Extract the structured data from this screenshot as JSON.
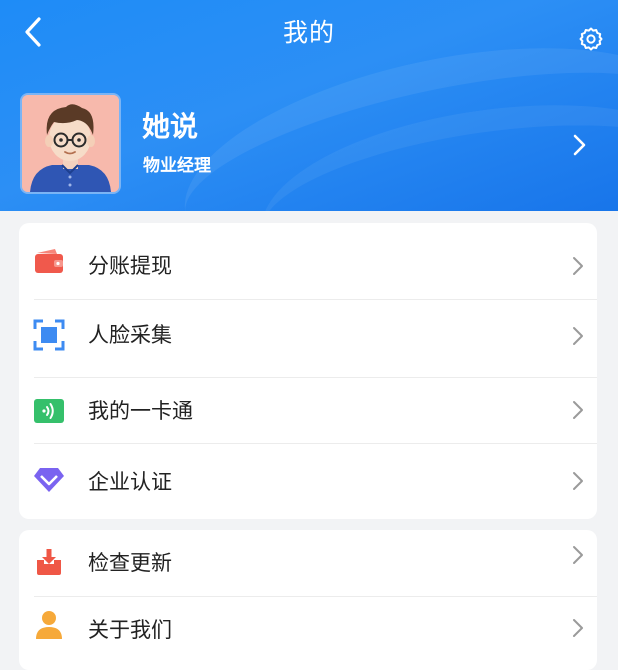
{
  "header": {
    "title": "我的"
  },
  "profile": {
    "name": "她说",
    "role": "物业经理"
  },
  "menu_group_1": [
    {
      "label": "分账提现",
      "icon": "wallet-icon"
    },
    {
      "label": "人脸采集",
      "icon": "face-scan-icon"
    },
    {
      "label": "我的一卡通",
      "icon": "nfc-card-icon"
    },
    {
      "label": "企业认证",
      "icon": "diamond-icon"
    }
  ],
  "menu_group_2": [
    {
      "label": "检查更新",
      "icon": "download-tray-icon"
    },
    {
      "label": "关于我们",
      "icon": "person-icon"
    }
  ],
  "colors": {
    "header_blue": "#1e8cf7",
    "wallet_red": "#f0594c",
    "face_blue": "#3d8bf2",
    "card_green": "#35c06b",
    "diamond_purple": "#7a63f0",
    "update_red": "#ef5746",
    "person_orange": "#f6a93a"
  }
}
